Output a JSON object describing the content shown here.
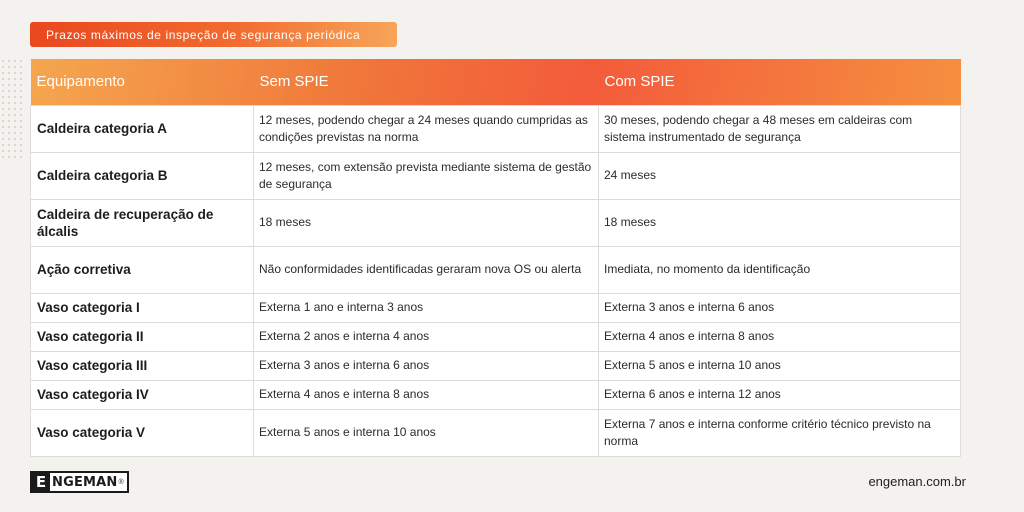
{
  "badge": {
    "title": "Prazos máximos de inspeção de segurança periódica"
  },
  "table": {
    "headers": [
      "Equipamento",
      "Sem SPIE",
      "Com SPIE"
    ],
    "rows": [
      [
        "Caldeira categoria A",
        "12 meses, podendo chegar a 24 meses quando cumpridas as condições previstas na norma",
        "30 meses, podendo chegar a 48 meses em caldeiras com sistema instrumentado de segurança"
      ],
      [
        "Caldeira categoria B",
        "12 meses, com extensão prevista mediante sistema de gestão de segurança",
        "24 meses"
      ],
      [
        "Caldeira de recuperação de álcalis",
        "18 meses",
        "18 meses"
      ],
      [
        "Ação corretiva",
        "Não conformidades identificadas geraram nova OS ou alerta",
        "Imediata, no momento da identificação"
      ],
      [
        "Vaso categoria I",
        "Externa 1 ano e interna 3 anos",
        "Externa 3 anos e interna 6 anos"
      ],
      [
        "Vaso categoria II",
        "Externa 2 anos e interna 4 anos",
        "Externa 4 anos e interna 8 anos"
      ],
      [
        "Vaso categoria III",
        "Externa 3 anos e interna 6 anos",
        "Externa 5 anos e interna 10 anos"
      ],
      [
        "Vaso categoria IV",
        "Externa 4 anos e interna 8 anos",
        "Externa 6 anos e interna 12 anos"
      ],
      [
        "Vaso categoria V",
        "Externa 5 anos e interna 10 anos",
        "Externa 7 anos e interna conforme critério técnico previsto na norma"
      ]
    ]
  },
  "footer": {
    "logo_mark": "E",
    "logo_text": "NGEMAN",
    "logo_registered": "®",
    "website": "engeman.com.br"
  },
  "colors": {
    "accent": "#f26a2f",
    "background": "#f4f2ef"
  }
}
